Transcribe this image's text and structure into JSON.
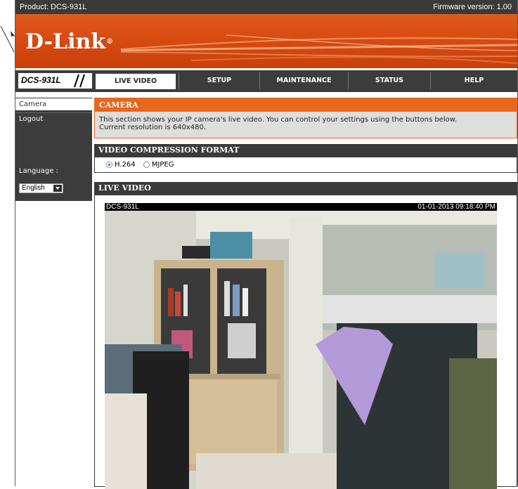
{
  "header": {
    "product": "Product: DCS-931L",
    "firmware": "Firmware version: 1.00"
  },
  "brand": {
    "logo": "D-Link",
    "registered_mark": "®"
  },
  "nav": {
    "model": "DCS-931L",
    "tabs": [
      {
        "label": "LIVE VIDEO",
        "active": true
      },
      {
        "label": "SETUP",
        "active": false
      },
      {
        "label": "MAINTENANCE",
        "active": false
      },
      {
        "label": "STATUS",
        "active": false
      },
      {
        "label": "HELP",
        "active": false
      }
    ]
  },
  "sidebar": {
    "items": [
      {
        "label": "Camera",
        "active": true
      },
      {
        "label": "Logout",
        "active": false
      }
    ],
    "language_label": "Language :",
    "language_value": "English"
  },
  "camera_section": {
    "title": "CAMERA",
    "description_line1": "This section shows your IP camera's live video. You can control your settings using the buttons below.",
    "description_line2": "Current resolution is 640x480."
  },
  "compression": {
    "title": "VIDEO COMPRESSION FORMAT",
    "options": [
      {
        "label": "H.264",
        "selected": true
      },
      {
        "label": "MJPEG",
        "selected": false
      }
    ]
  },
  "live_video": {
    "title": "LIVE VIDEO",
    "camera_name": "DCS-931L",
    "timestamp": "01-01-2013 09:18:40 PM"
  },
  "colors": {
    "accent_orange": "#e8671d",
    "dark_bar": "#3a3a3a",
    "selected_radio": "#1f5fbf"
  }
}
